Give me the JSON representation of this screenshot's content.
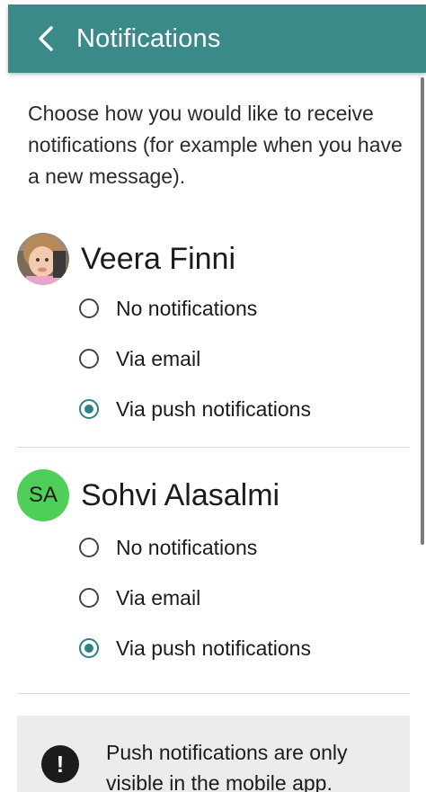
{
  "header": {
    "title": "Notifications",
    "back_icon": "chevron-left-icon",
    "background_color": "#3b8a8a"
  },
  "intro_text": "Choose how you would like to receive notifications (for example when you have a new message).",
  "people": [
    {
      "name": "Veera Finni",
      "avatar_type": "photo",
      "options": [
        {
          "label": "No notifications",
          "selected": false
        },
        {
          "label": "Via email",
          "selected": false
        },
        {
          "label": "Via push notifications",
          "selected": true
        }
      ]
    },
    {
      "name": "Sohvi Alasalmi",
      "avatar_type": "initials",
      "initials": "SA",
      "avatar_color": "#4fcf5a",
      "options": [
        {
          "label": "No notifications",
          "selected": false
        },
        {
          "label": "Via email",
          "selected": false
        },
        {
          "label": "Via push notifications",
          "selected": true
        }
      ]
    }
  ],
  "info_box": {
    "icon": "exclamation-icon",
    "text": "Push notifications are only visible in the mobile app."
  },
  "accent_color": "#2f8080"
}
